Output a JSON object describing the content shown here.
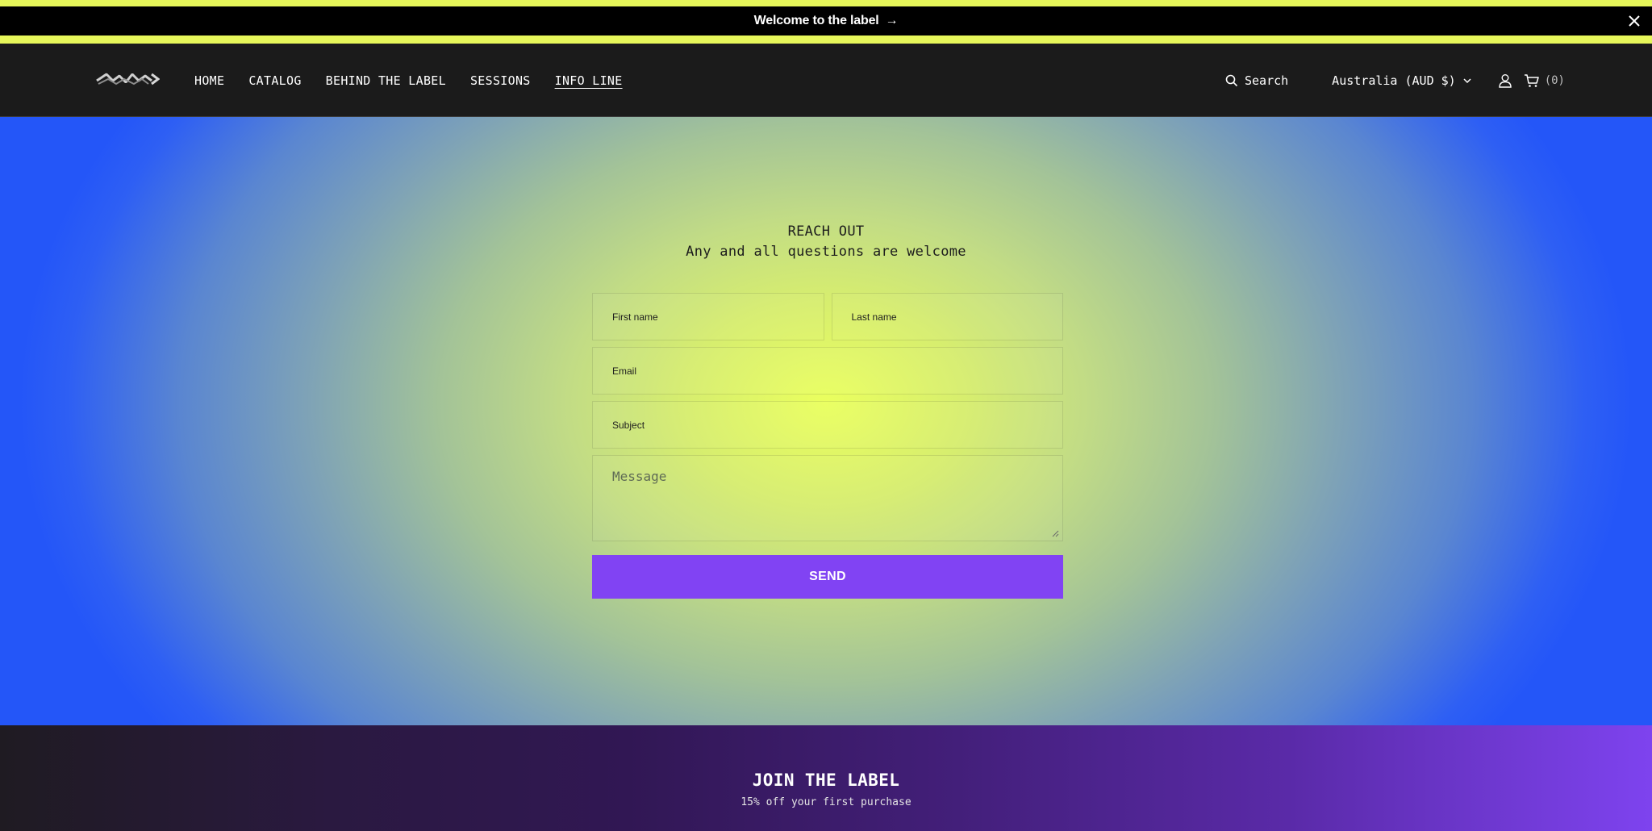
{
  "announcement": {
    "text": "Welcome to the label",
    "arrow": "→",
    "close_icon": "close-icon"
  },
  "header": {
    "logo_icon": "brand-logo",
    "nav": [
      {
        "label": "HOME",
        "active": false
      },
      {
        "label": "CATALOG",
        "active": false
      },
      {
        "label": "BEHIND THE LABEL",
        "active": false
      },
      {
        "label": "SESSIONS",
        "active": false
      },
      {
        "label": "INFO LINE",
        "active": true
      }
    ],
    "search_label": "Search",
    "country_selector": "Australia (AUD $)",
    "cart_count": "(0)"
  },
  "contact": {
    "title": "REACH OUT",
    "subtitle": "Any and all questions are welcome",
    "fields": {
      "first_name": "First name",
      "last_name": "Last name",
      "email": "Email",
      "subject": "Subject",
      "message": "Message"
    },
    "send_label": "SEND"
  },
  "join": {
    "title": "JOIN THE LABEL",
    "subtitle": "15% off your first purchase"
  },
  "colors": {
    "announce_yellow": "#e6f65a",
    "header_bg": "#1b1b1b",
    "send_purple": "#8143f3",
    "hero_center": "#eaff5e",
    "hero_edge": "#2456f8"
  }
}
